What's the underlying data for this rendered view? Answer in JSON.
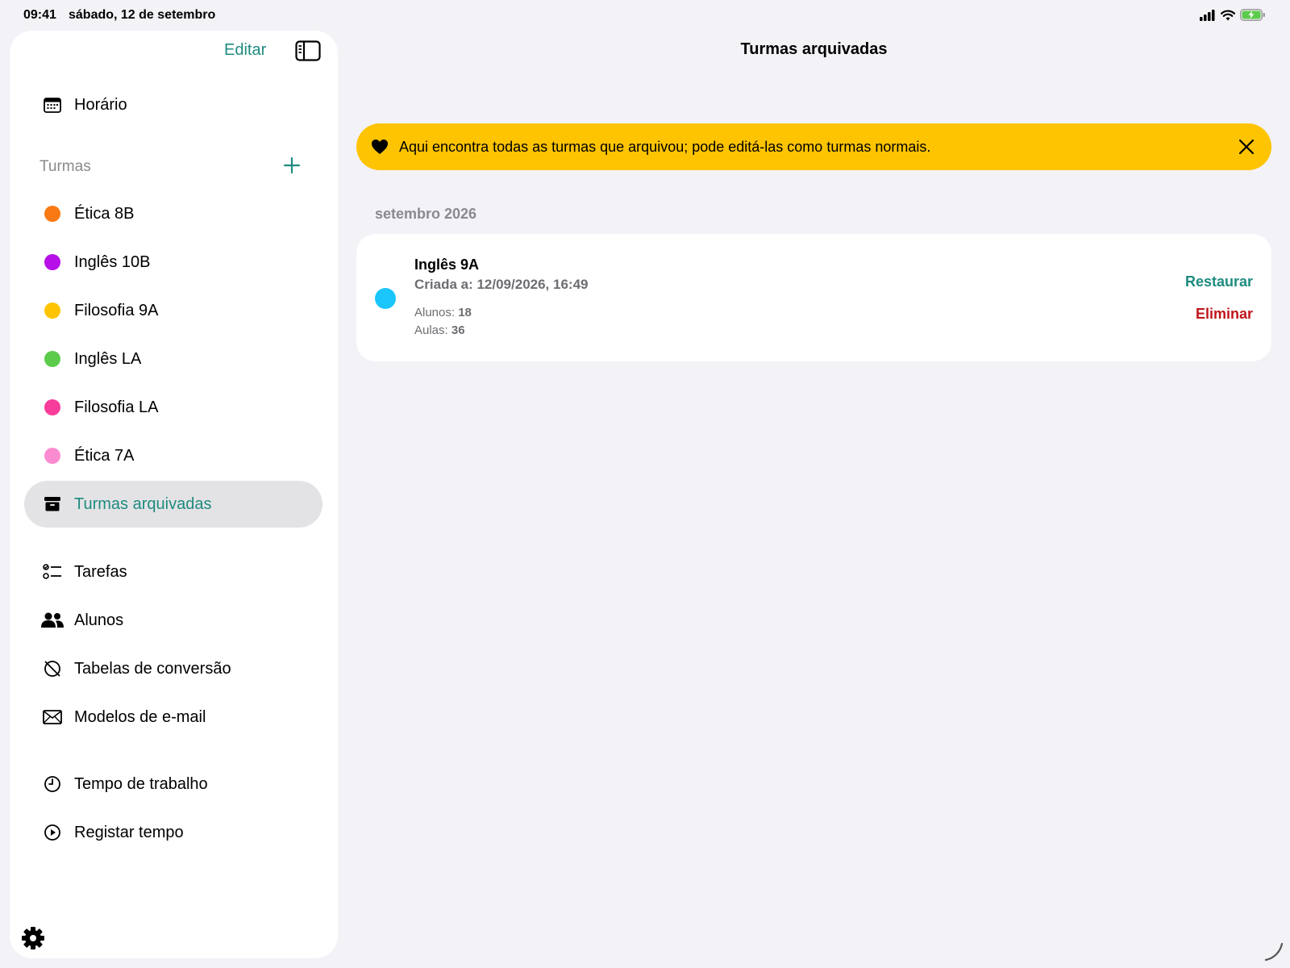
{
  "status": {
    "time": "09:41",
    "date": "sábado, 12 de setembro"
  },
  "sidebar": {
    "edit_label": "Editar",
    "top_item": {
      "label": "Horário",
      "icon": "calendar-icon"
    },
    "section_title": "Turmas",
    "classes": [
      {
        "label": "Ética 8B",
        "color": "#f97a12"
      },
      {
        "label": "Inglês 10B",
        "color": "#b60fe8"
      },
      {
        "label": "Filosofia 9A",
        "color": "#fec402"
      },
      {
        "label": "Inglês LA",
        "color": "#5ccb4c"
      },
      {
        "label": "Filosofia LA",
        "color": "#f63d9b"
      },
      {
        "label": "Ética 7A",
        "color": "#fb8bd0"
      }
    ],
    "archived": {
      "label": "Turmas arquivadas",
      "icon": "archive-box-icon"
    },
    "tools": [
      {
        "label": "Tarefas",
        "icon": "checklist-icon"
      },
      {
        "label": "Alunos",
        "icon": "people-icon"
      },
      {
        "label": "Tabelas de conversão",
        "icon": "conversion-icon"
      },
      {
        "label": "Modelos de e-mail",
        "icon": "envelope-icon"
      }
    ],
    "time_items": [
      {
        "label": "Tempo de trabalho",
        "icon": "clock-icon"
      },
      {
        "label": "Registar tempo",
        "icon": "play-circle-icon"
      }
    ]
  },
  "main": {
    "title": "Turmas arquivadas",
    "banner_text": "Aqui encontra todas as turmas que arquivou; pode editá-las como turmas normais.",
    "section_label": "setembro 2026",
    "card": {
      "name": "Inglês 9A",
      "created": "Criada a: 12/09/2026, 16:49",
      "students_label": "Alunos:",
      "students_value": "18",
      "lessons_label": "Aulas:",
      "lessons_value": "36",
      "restore_label": "Restaurar",
      "delete_label": "Eliminar",
      "color": "#1ac6fb"
    }
  },
  "colors": {
    "accent": "#1e8b7f",
    "banner": "#fec402",
    "danger": "#c0161b"
  }
}
